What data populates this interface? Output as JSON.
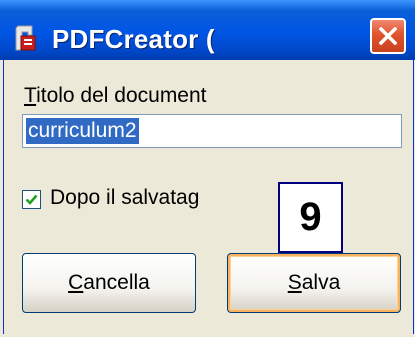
{
  "window": {
    "title": "PDFCreator (",
    "icon": "pdfcreator-app-icon",
    "close_icon": "close-icon",
    "colors": {
      "titlebar": "#0055e5",
      "close": "#e0542e",
      "face": "#ece9d8",
      "selection": "#316ac5"
    }
  },
  "document": {
    "label_mnemonic": "T",
    "label_rest": "itolo del document",
    "input_value": "curriculum2"
  },
  "option": {
    "checked": true,
    "label": "Dopo il salvatag"
  },
  "annotation": {
    "number": "9"
  },
  "buttons": {
    "cancel_mnemonic": "C",
    "cancel_rest": "ancella",
    "save_mnemonic": "S",
    "save_rest": "alva"
  }
}
